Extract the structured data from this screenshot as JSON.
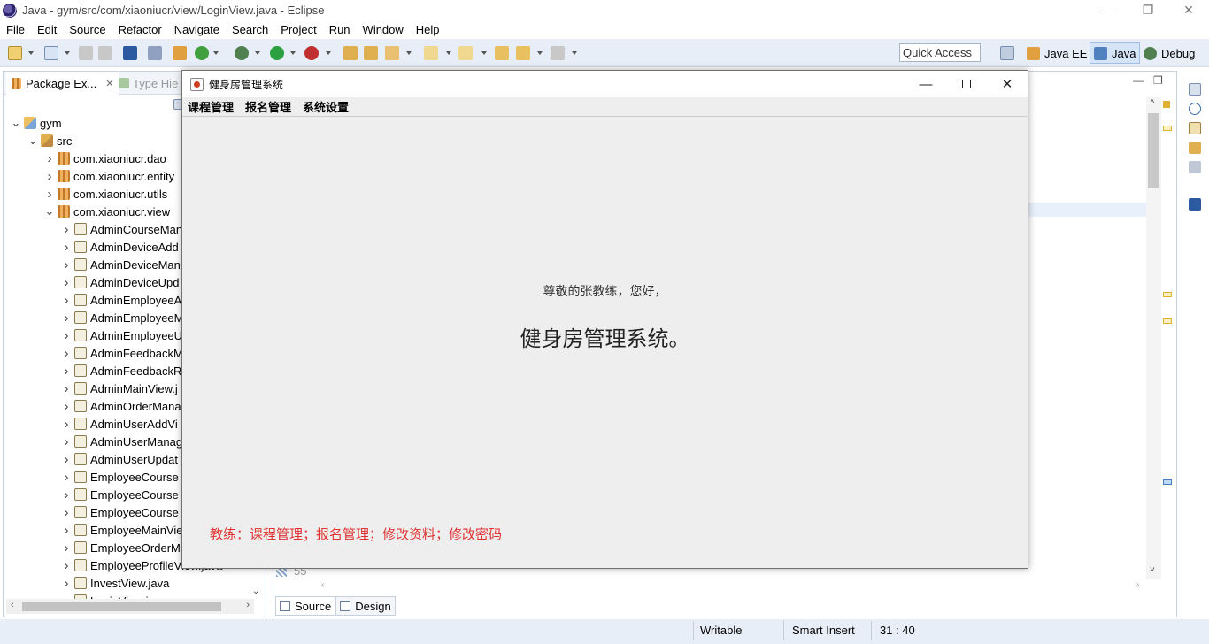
{
  "window": {
    "title": "Java - gym/src/com/xiaoniucr/view/LoginView.java - Eclipse",
    "minimize": "—",
    "maximize": "❐",
    "close": "✕"
  },
  "menubar": [
    "File",
    "Edit",
    "Source",
    "Refactor",
    "Navigate",
    "Search",
    "Project",
    "Run",
    "Window",
    "Help"
  ],
  "toolbar": {
    "quick_access": "Quick Access",
    "perspectives": [
      "Java EE",
      "Java",
      "Debug"
    ]
  },
  "package_explorer": {
    "tab_label": "Package Ex...",
    "tab_close": "✕",
    "type_tab_label": "Type Hie",
    "tree": [
      {
        "label": "gym",
        "icon": "project-icon",
        "depth": 0,
        "expanded": true
      },
      {
        "label": "src",
        "icon": "source-folder-icon",
        "depth": 1,
        "expanded": true
      },
      {
        "label": "com.xiaoniucr.dao",
        "icon": "package-icon",
        "depth": 2,
        "expanded": false
      },
      {
        "label": "com.xiaoniucr.entity",
        "icon": "package-icon",
        "depth": 2,
        "expanded": false
      },
      {
        "label": "com.xiaoniucr.utils",
        "icon": "package-icon",
        "depth": 2,
        "expanded": false
      },
      {
        "label": "com.xiaoniucr.view",
        "icon": "package-icon",
        "depth": 2,
        "expanded": true
      },
      {
        "label": "AdminCourseMan",
        "icon": "java-file-icon",
        "depth": 3
      },
      {
        "label": "AdminDeviceAdd",
        "icon": "java-file-icon",
        "depth": 3
      },
      {
        "label": "AdminDeviceMan",
        "icon": "java-file-icon",
        "depth": 3
      },
      {
        "label": "AdminDeviceUpd",
        "icon": "java-file-icon",
        "depth": 3
      },
      {
        "label": "AdminEmployeeA",
        "icon": "java-file-icon",
        "depth": 3
      },
      {
        "label": "AdminEmployeeM",
        "icon": "java-file-icon",
        "depth": 3
      },
      {
        "label": "AdminEmployeeU",
        "icon": "java-file-icon",
        "depth": 3
      },
      {
        "label": "AdminFeedbackM",
        "icon": "java-file-icon",
        "depth": 3
      },
      {
        "label": "AdminFeedbackR",
        "icon": "java-file-icon",
        "depth": 3
      },
      {
        "label": "AdminMainView.j",
        "icon": "java-file-icon",
        "depth": 3
      },
      {
        "label": "AdminOrderMana",
        "icon": "java-file-icon",
        "depth": 3
      },
      {
        "label": "AdminUserAddVi",
        "icon": "java-file-icon",
        "depth": 3
      },
      {
        "label": "AdminUserManag",
        "icon": "java-file-icon",
        "depth": 3
      },
      {
        "label": "AdminUserUpdat",
        "icon": "java-file-icon",
        "depth": 3
      },
      {
        "label": "EmployeeCourse",
        "icon": "java-file-icon",
        "depth": 3
      },
      {
        "label": "EmployeeCourse",
        "icon": "java-file-icon",
        "depth": 3
      },
      {
        "label": "EmployeeCourse",
        "icon": "java-file-icon",
        "depth": 3
      },
      {
        "label": "EmployeeMainVie",
        "icon": "java-file-icon",
        "depth": 3
      },
      {
        "label": "EmployeeOrderM",
        "icon": "java-file-icon",
        "depth": 3
      },
      {
        "label": "EmployeeProfileView.java",
        "icon": "java-file-icon",
        "depth": 3
      },
      {
        "label": "InvestView.java",
        "icon": "java-file-icon",
        "depth": 3
      },
      {
        "label": "LoginView.java",
        "icon": "java-file-icon",
        "depth": 3
      }
    ]
  },
  "editor": {
    "line_number": "55",
    "bottom_tabs": [
      "Source",
      "Design"
    ]
  },
  "statusbar": {
    "writable": "Writable",
    "insert_mode": "Smart Insert",
    "position": "31 : 40"
  },
  "dialog": {
    "title": "健身房管理系统",
    "menus": [
      "课程管理",
      "报名管理",
      "系统设置"
    ],
    "greeting": "尊敬的张教练，您好，",
    "system_name": "健身房管理系统。",
    "role_hint": "教练：课程管理；报名管理；修改资料；修改密码",
    "role_hint_color": "#e03030"
  }
}
